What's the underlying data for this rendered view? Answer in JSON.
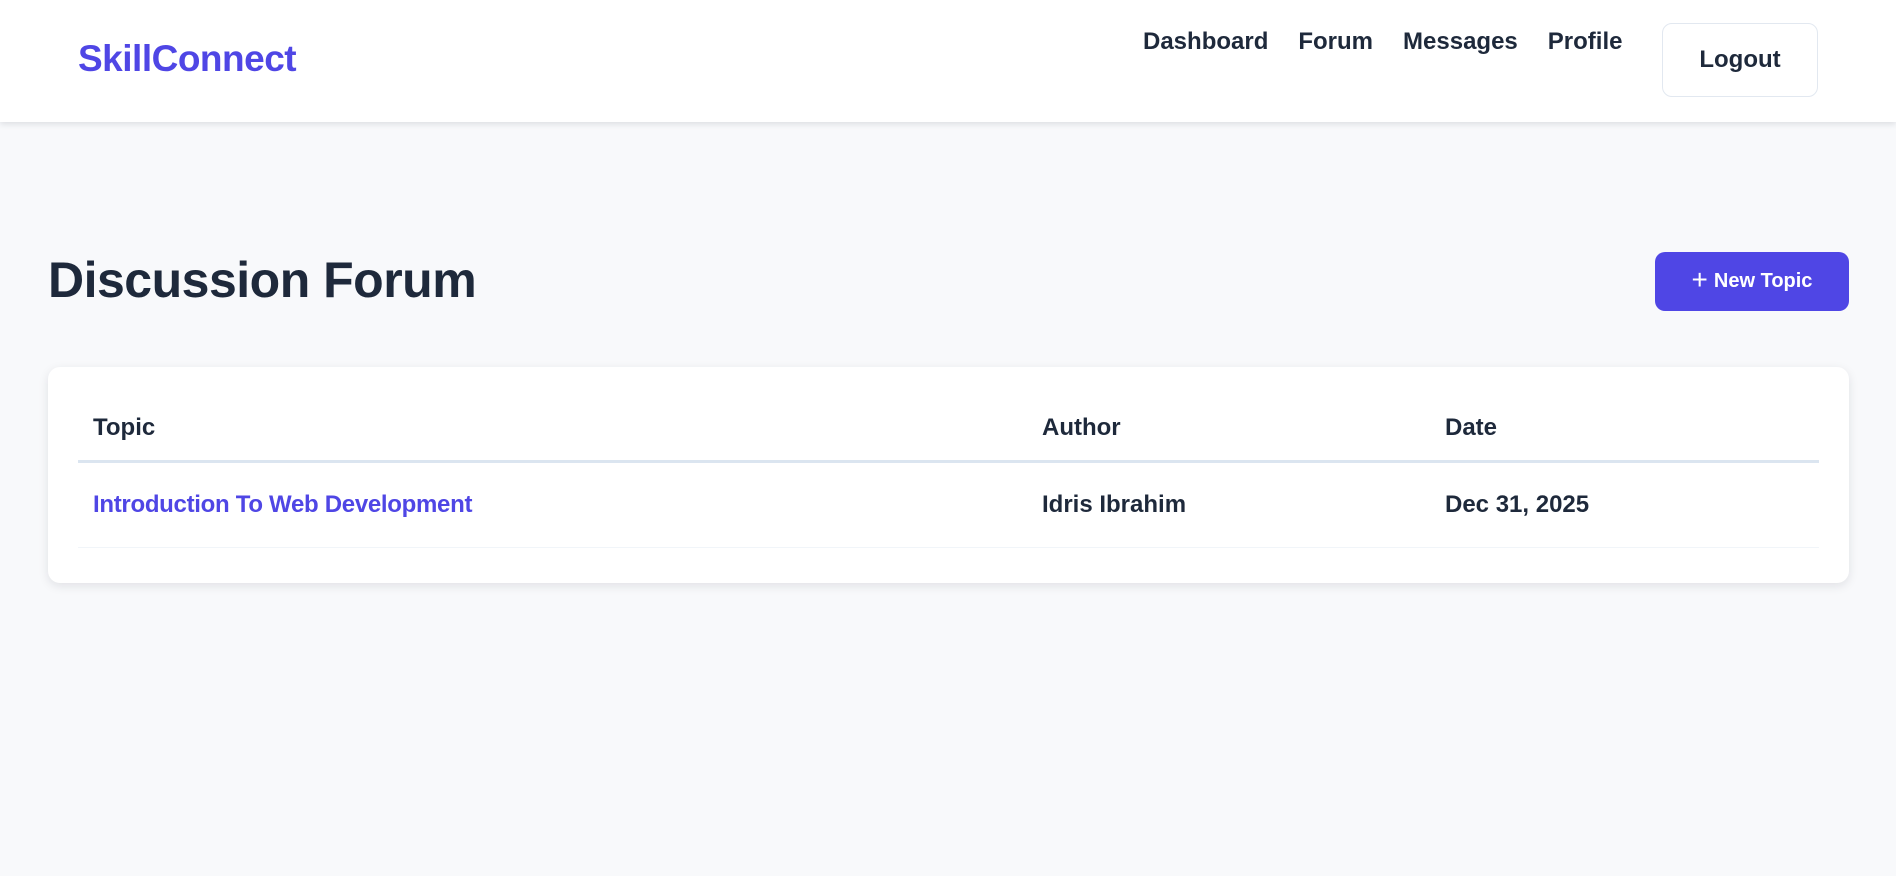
{
  "header": {
    "brand": "SkillConnect",
    "nav": [
      {
        "label": "Dashboard"
      },
      {
        "label": "Forum"
      },
      {
        "label": "Messages"
      },
      {
        "label": "Profile"
      }
    ],
    "logout_label": "Logout"
  },
  "main": {
    "title": "Discussion Forum",
    "new_topic_label": "New Topic",
    "new_topic_icon": "plus-icon",
    "table": {
      "columns": [
        "Topic",
        "Author",
        "Date"
      ],
      "rows": [
        {
          "topic": "Introduction To Web Development",
          "author": "Idris Ibrahim",
          "date": "Dec 31, 2025"
        }
      ]
    }
  },
  "colors": {
    "accent": "#4f46e5",
    "text": "#1e293b",
    "background": "#f8f9fb"
  }
}
